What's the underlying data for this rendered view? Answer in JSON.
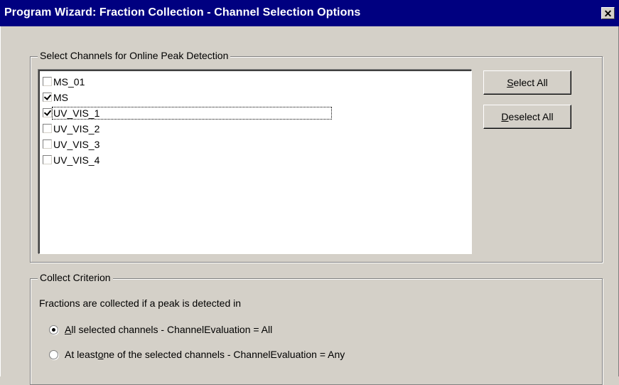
{
  "window": {
    "title": "Program Wizard: Fraction Collection - Channel Selection Options",
    "close_glyph": "✕"
  },
  "channels_group": {
    "title": "Select Channels for Online Peak Detection",
    "items": [
      {
        "label": "MS_01",
        "checked": false
      },
      {
        "label": "MS",
        "checked": true
      },
      {
        "label": "UV_VIS_1",
        "checked": true,
        "focused": true
      },
      {
        "label": "UV_VIS_2",
        "checked": false
      },
      {
        "label": "UV_VIS_3",
        "checked": false
      },
      {
        "label": "UV_VIS_4",
        "checked": false
      }
    ],
    "select_all": {
      "mnemonic": "S",
      "rest": "elect All"
    },
    "deselect_all": {
      "mnemonic": "D",
      "rest": "eselect All"
    }
  },
  "criterion_group": {
    "title": "Collect Criterion",
    "description": "Fractions are collected if a peak is detected in",
    "options": [
      {
        "prefix": "",
        "mnemonic": "A",
        "rest": "ll selected channels - ChannelEvaluation = All",
        "selected": true
      },
      {
        "prefix": "At least ",
        "mnemonic": "o",
        "rest": "ne of the selected channels - ChannelEvaluation = Any",
        "selected": false
      }
    ]
  }
}
